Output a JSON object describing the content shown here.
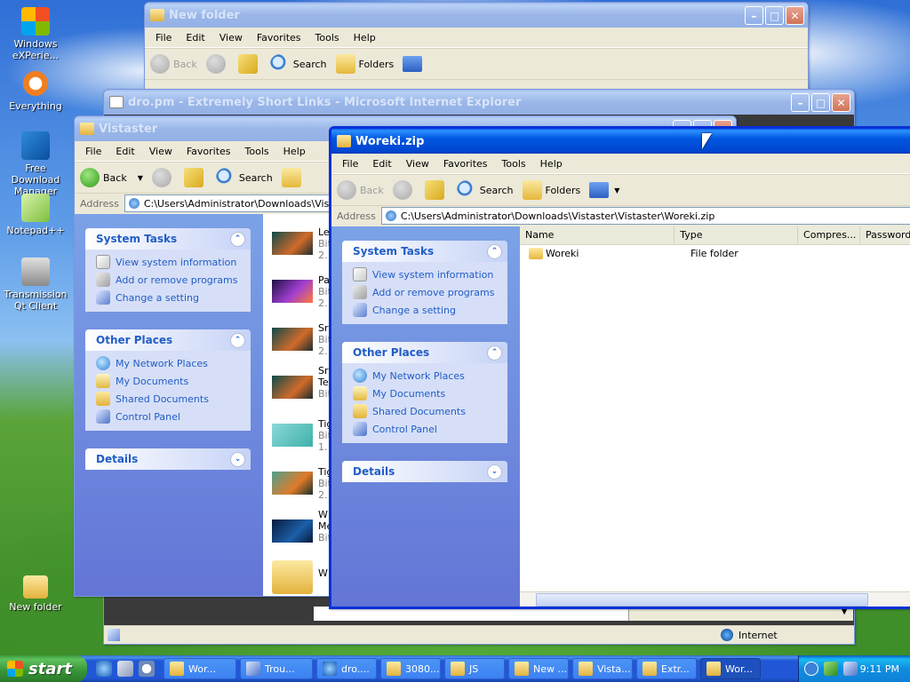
{
  "desktop": {
    "icons": [
      {
        "label": "Windows eXPerie..."
      },
      {
        "label": "Everything"
      },
      {
        "label": "Free Download Manager"
      },
      {
        "label": "Notepad++"
      },
      {
        "label": "Transmission Qt Client"
      },
      {
        "label": "New folder"
      }
    ]
  },
  "menu_items": [
    "File",
    "Edit",
    "View",
    "Favorites",
    "Tools",
    "Help"
  ],
  "toolbar": {
    "back": "Back",
    "search": "Search",
    "folders": "Folders"
  },
  "address_label": "Address",
  "window_new_folder": {
    "title": "New folder"
  },
  "window_ie": {
    "title": "dro.pm - Extremely Short Links - Microsoft Internet Explorer",
    "status_zone": "Internet"
  },
  "window_vistaster": {
    "title": "Vistaster",
    "address": "C:\\Users\\Administrator\\Downloads\\Vistaster",
    "files": [
      {
        "l1": "Le",
        "l2": "Bit",
        "l3": "2."
      },
      {
        "l1": "Pa",
        "l2": "Bit",
        "l3": "2."
      },
      {
        "l1": "Sr",
        "l2": "Bit",
        "l3": "2."
      },
      {
        "l1": "Sr",
        "l2": "Te",
        "l3": "Bit"
      },
      {
        "l1": "Tig",
        "l2": "Bit",
        "l3": "1."
      },
      {
        "l1": "Tig",
        "l2": "Bit",
        "l3": "2."
      },
      {
        "l1": "W",
        "l2": "Me",
        "l3": "Bit"
      },
      {
        "l1": "W",
        "l2": "",
        "l3": ""
      }
    ]
  },
  "window_woreki": {
    "title": "Woreki.zip",
    "address": "C:\\Users\\Administrator\\Downloads\\Vistaster\\Vistaster\\Woreki.zip",
    "columns": [
      "Name",
      "Type",
      "Compres...",
      "Password"
    ],
    "rows": [
      {
        "name": "Woreki",
        "type": "File folder"
      }
    ]
  },
  "task_panes": {
    "system_tasks": {
      "title": "System Tasks",
      "items": [
        "View system information",
        "Add or remove programs",
        "Change a setting"
      ]
    },
    "other_places": {
      "title": "Other Places",
      "items": [
        "My Network Places",
        "My Documents",
        "Shared Documents",
        "Control Panel"
      ]
    },
    "details": {
      "title": "Details"
    }
  },
  "taskbar": {
    "start": "start",
    "tasks": [
      "Wor...",
      "Trou...",
      "dro....",
      "3080...",
      "JS",
      "New ...",
      "Vista...",
      "Extr...",
      "Wor..."
    ],
    "active_task_index": 8,
    "clock": "9:11 PM"
  },
  "colors": {
    "xp_blue": "#0054e3",
    "task_link": "#215dc6",
    "start_green": "#3c9a3c"
  }
}
